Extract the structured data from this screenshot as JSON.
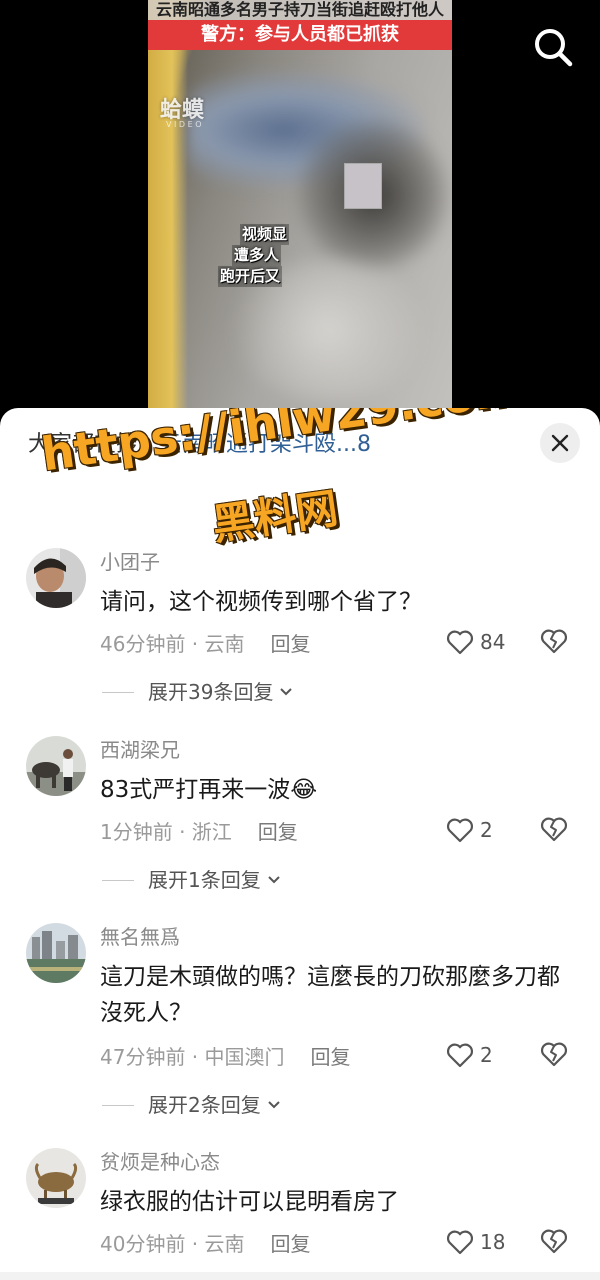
{
  "video": {
    "headline_top": "云南昭通多名男子持刀当街追赶殴打他人",
    "headline_red": "警方：参与人员都已抓获",
    "channel_logo": "蛤蟆",
    "channel_logo_sub": "V I D E O",
    "caption_lines": [
      "视频显",
      "遭多人",
      "跑开后又"
    ]
  },
  "sheet": {
    "hot_search_prefix": "大家都在搜：",
    "hot_search_term": "云南昭通打架斗殴...8"
  },
  "watermark": {
    "url": "https://ihlw29.com",
    "name": "黑料网"
  },
  "comments": [
    {
      "username": "小团子",
      "text": "请问，这个视频传到哪个省了？",
      "meta": "46分钟前 · 云南",
      "reply_label": "回复",
      "likes": "84",
      "expand_label": "展开39条回复"
    },
    {
      "username": "西湖梁兄",
      "text": "83式严打再来一波😂",
      "meta": "1分钟前 · 浙江",
      "reply_label": "回复",
      "likes": "2",
      "expand_label": "展开1条回复"
    },
    {
      "username": "無名無爲",
      "text": "這刀是木頭做的嗎？這麼長的刀砍那麼多刀都沒死人？",
      "meta": "47分钟前 · 中国澳门",
      "reply_label": "回复",
      "likes": "2",
      "expand_label": "展开2条回复"
    },
    {
      "username": "贫烦是种心态",
      "text": "绿衣服的估计可以昆明看房了",
      "meta": "40分钟前 · 云南",
      "reply_label": "回复",
      "likes": "18"
    }
  ],
  "icons": {
    "search": "search-icon",
    "close": "close-icon",
    "like": "heart-outline-icon",
    "dislike": "broken-heart-icon",
    "expand": "chevron-down-icon"
  },
  "colors": {
    "headline_red": "#e23a3a",
    "hot_search_term": "#2f5f95",
    "watermark": "#f6a623"
  }
}
